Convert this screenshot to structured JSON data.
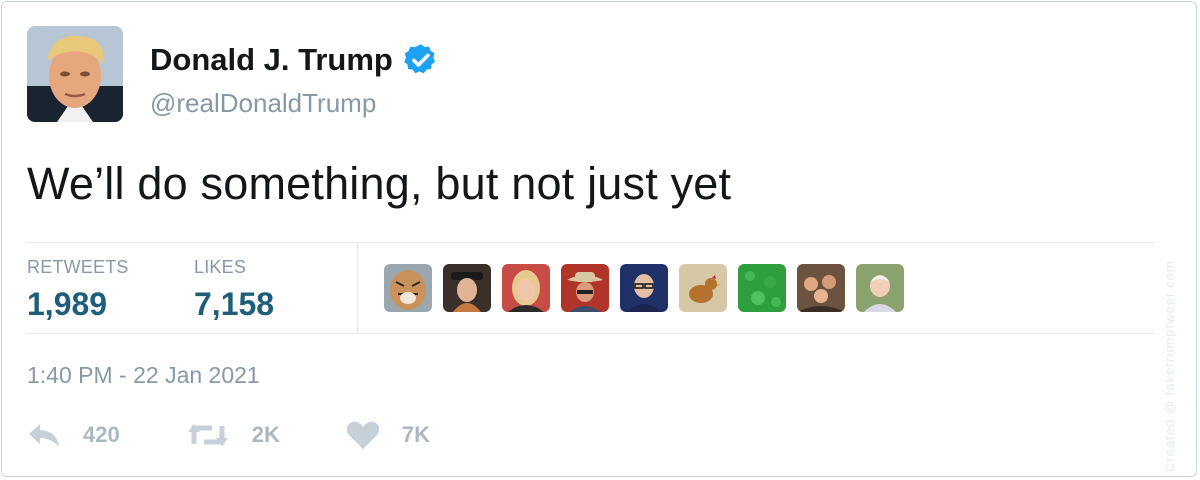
{
  "author": {
    "name": "Donald J. Trump",
    "handle": "@realDonaldTrump",
    "avatar_icon": "profile-photo",
    "verified_icon": "verified-badge-icon"
  },
  "tweet": {
    "text": "We’ll do something, but not just yet"
  },
  "stats": {
    "retweets_label": "RETWEETS",
    "retweets_value": "1,989",
    "likes_label": "LIKES",
    "likes_value": "7,158"
  },
  "likers": [
    "tiger",
    "person-hat",
    "woman-blonde",
    "cowboy",
    "man-glasses",
    "chicken",
    "green-field",
    "group-photo",
    "child-photo"
  ],
  "timestamp": "1:40 PM - 22 Jan 2021",
  "actions": {
    "reply_count": "420",
    "retweet_count": "2K",
    "like_count": "7K"
  },
  "watermark": "Created @ faketrumptweet.com",
  "colors": {
    "accent": "#1da1f2",
    "stat_value": "#1d5f7a",
    "muted": "#8899a6"
  }
}
